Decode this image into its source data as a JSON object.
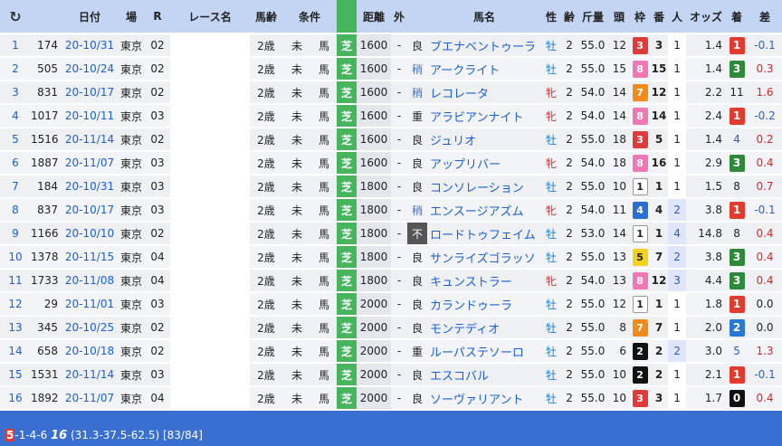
{
  "header": {
    "reload": "C",
    "cols": [
      "日付",
      "場",
      "R",
      "レース名",
      "馬齢",
      "条件",
      "",
      "距離",
      "外",
      "",
      "馬名",
      "性",
      "齢",
      "斤量",
      "頭",
      "枠",
      "番",
      "人",
      "オッズ",
      "着",
      "差"
    ]
  },
  "rows": [
    {
      "no": "1",
      "id": "174",
      "date": "20-10/31",
      "place": "東京",
      "r": "02",
      "race": "",
      "age": "2歳",
      "cond": "未",
      "horse_type": "馬",
      "track": "芝",
      "dist": "1600",
      "out": "-",
      "baba": "良",
      "name": "ブエナベントゥーラ",
      "sex": "牡",
      "sage": "2",
      "kin": "55.0",
      "tou": "12",
      "waku": "3",
      "ban": "3",
      "pop": "1",
      "odds": "1.4",
      "fin": "1",
      "diff": "-0.1"
    },
    {
      "no": "2",
      "id": "505",
      "date": "20-10/24",
      "place": "東京",
      "r": "02",
      "race": "",
      "age": "2歳",
      "cond": "未",
      "horse_type": "馬",
      "track": "芝",
      "dist": "1600",
      "out": "-",
      "baba": "稍",
      "name": "アークライト",
      "sex": "牡",
      "sage": "2",
      "kin": "55.0",
      "tou": "15",
      "waku": "8",
      "ban": "15",
      "pop": "1",
      "odds": "1.4",
      "fin": "3",
      "diff": "0.3"
    },
    {
      "no": "3",
      "id": "831",
      "date": "20-10/17",
      "place": "東京",
      "r": "02",
      "race": "",
      "age": "2歳",
      "cond": "未",
      "horse_type": "馬",
      "track": "芝",
      "dist": "1600",
      "out": "-",
      "baba": "稍",
      "name": "レコレータ",
      "sex": "牝",
      "sage": "2",
      "kin": "54.0",
      "tou": "14",
      "waku": "7",
      "ban": "12",
      "pop": "1",
      "odds": "2.2",
      "fin": "11",
      "diff": "1.6"
    },
    {
      "no": "4",
      "id": "1017",
      "date": "20-10/11",
      "place": "東京",
      "r": "03",
      "race": "",
      "age": "2歳",
      "cond": "未",
      "horse_type": "馬",
      "track": "芝",
      "dist": "1600",
      "out": "-",
      "baba": "重",
      "name": "アラビアンナイト",
      "sex": "牝",
      "sage": "2",
      "kin": "54.0",
      "tou": "14",
      "waku": "8",
      "ban": "14",
      "pop": "1",
      "odds": "2.4",
      "fin": "1",
      "diff": "-0.2"
    },
    {
      "no": "5",
      "id": "1516",
      "date": "20-11/14",
      "place": "東京",
      "r": "02",
      "race": "",
      "age": "2歳",
      "cond": "未",
      "horse_type": "馬",
      "track": "芝",
      "dist": "1600",
      "out": "-",
      "baba": "良",
      "name": "ジュリオ",
      "sex": "牡",
      "sage": "2",
      "kin": "55.0",
      "tou": "18",
      "waku": "3",
      "ban": "5",
      "pop": "1",
      "odds": "1.4",
      "fin": "4",
      "diff": "0.2"
    },
    {
      "no": "6",
      "id": "1887",
      "date": "20-11/07",
      "place": "東京",
      "r": "03",
      "race": "",
      "age": "2歳",
      "cond": "未",
      "horse_type": "馬",
      "track": "芝",
      "dist": "1600",
      "out": "-",
      "baba": "良",
      "name": "アップリバー",
      "sex": "牝",
      "sage": "2",
      "kin": "54.0",
      "tou": "18",
      "waku": "8",
      "ban": "16",
      "pop": "1",
      "odds": "2.9",
      "fin": "3",
      "diff": "0.4"
    },
    {
      "no": "7",
      "id": "184",
      "date": "20-10/31",
      "place": "東京",
      "r": "03",
      "race": "",
      "age": "2歳",
      "cond": "未",
      "horse_type": "馬",
      "track": "芝",
      "dist": "1800",
      "out": "-",
      "baba": "良",
      "name": "コンソレーション",
      "sex": "牡",
      "sage": "2",
      "kin": "55.0",
      "tou": "10",
      "waku": "1",
      "ban": "1",
      "pop": "1",
      "odds": "1.5",
      "fin": "8",
      "diff": "0.7"
    },
    {
      "no": "8",
      "id": "837",
      "date": "20-10/17",
      "place": "東京",
      "r": "03",
      "race": "",
      "age": "2歳",
      "cond": "未",
      "horse_type": "馬",
      "track": "芝",
      "dist": "1800",
      "out": "-",
      "baba": "稍",
      "name": "エンスージアズム",
      "sex": "牝",
      "sage": "2",
      "kin": "54.0",
      "tou": "11",
      "waku": "4",
      "ban": "4",
      "pop": "2",
      "odds": "3.8",
      "fin": "1",
      "diff": "-0.1"
    },
    {
      "no": "9",
      "id": "1166",
      "date": "20-10/10",
      "place": "東京",
      "r": "02",
      "race": "",
      "age": "2歳",
      "cond": "未",
      "horse_type": "馬",
      "track": "芝",
      "dist": "1800",
      "out": "-",
      "baba": "不",
      "name": "ロードトゥフェイム",
      "sex": "牡",
      "sage": "2",
      "kin": "53.0",
      "tou": "14",
      "waku": "1",
      "ban": "1",
      "pop": "4",
      "odds": "14.8",
      "fin": "8",
      "diff": "0.4"
    },
    {
      "no": "10",
      "id": "1378",
      "date": "20-11/15",
      "place": "東京",
      "r": "04",
      "race": "",
      "age": "2歳",
      "cond": "未",
      "horse_type": "馬",
      "track": "芝",
      "dist": "1800",
      "out": "-",
      "baba": "良",
      "name": "サンライズゴラッソ",
      "sex": "牡",
      "sage": "2",
      "kin": "55.0",
      "tou": "13",
      "waku": "5",
      "ban": "7",
      "pop": "2",
      "odds": "3.8",
      "fin": "3",
      "diff": "0.4"
    },
    {
      "no": "11",
      "id": "1733",
      "date": "20-11/08",
      "place": "東京",
      "r": "04",
      "race": "",
      "age": "2歳",
      "cond": "未",
      "horse_type": "馬",
      "track": "芝",
      "dist": "1800",
      "out": "-",
      "baba": "良",
      "name": "キュンストラー",
      "sex": "牝",
      "sage": "2",
      "kin": "54.0",
      "tou": "13",
      "waku": "8",
      "ban": "12",
      "pop": "3",
      "odds": "4.4",
      "fin": "3",
      "diff": "0.4"
    },
    {
      "no": "12",
      "id": "29",
      "date": "20-11/01",
      "place": "東京",
      "r": "03",
      "race": "",
      "age": "2歳",
      "cond": "未",
      "horse_type": "馬",
      "track": "芝",
      "dist": "2000",
      "out": "-",
      "baba": "良",
      "name": "カランドゥーラ",
      "sex": "牡",
      "sage": "2",
      "kin": "55.0",
      "tou": "12",
      "waku": "1",
      "ban": "1",
      "pop": "1",
      "odds": "1.8",
      "fin": "1",
      "diff": "0.0"
    },
    {
      "no": "13",
      "id": "345",
      "date": "20-10/25",
      "place": "東京",
      "r": "02",
      "race": "",
      "age": "2歳",
      "cond": "未",
      "horse_type": "馬",
      "track": "芝",
      "dist": "2000",
      "out": "-",
      "baba": "良",
      "name": "モンテディオ",
      "sex": "牡",
      "sage": "2",
      "kin": "55.0",
      "tou": "8",
      "waku": "7",
      "ban": "7",
      "pop": "1",
      "odds": "2.0",
      "fin": "2",
      "diff": "0.0"
    },
    {
      "no": "14",
      "id": "658",
      "date": "20-10/18",
      "place": "東京",
      "r": "02",
      "race": "",
      "age": "2歳",
      "cond": "未",
      "horse_type": "馬",
      "track": "芝",
      "dist": "2000",
      "out": "-",
      "baba": "重",
      "name": "ルーパステソーロ",
      "sex": "牡",
      "sage": "2",
      "kin": "55.0",
      "tou": "6",
      "waku": "2",
      "ban": "2",
      "pop": "2",
      "odds": "3.0",
      "fin": "5",
      "diff": "1.3"
    },
    {
      "no": "15",
      "id": "1531",
      "date": "20-11/14",
      "place": "東京",
      "r": "03",
      "race": "",
      "age": "2歳",
      "cond": "未",
      "horse_type": "馬",
      "track": "芝",
      "dist": "2000",
      "out": "-",
      "baba": "良",
      "name": "エスコバル",
      "sex": "牡",
      "sage": "2",
      "kin": "55.0",
      "tou": "10",
      "waku": "2",
      "ban": "2",
      "pop": "1",
      "odds": "2.1",
      "fin": "1",
      "diff": "-0.1"
    },
    {
      "no": "16",
      "id": "1892",
      "date": "20-11/07",
      "place": "東京",
      "r": "04",
      "race": "",
      "age": "2歳",
      "cond": "未",
      "horse_type": "馬",
      "track": "芝",
      "dist": "2000",
      "out": "-",
      "baba": "良",
      "name": "ソーヴァリアント",
      "sex": "牡",
      "sage": "2",
      "kin": "55.0",
      "tou": "10",
      "waku": "3",
      "ban": "3",
      "pop": "1",
      "odds": "1.7",
      "fin": "0",
      "diff": "0.4"
    }
  ],
  "footer": {
    "first": "5",
    "rest": "-1-4-6 ",
    "big": "16",
    "stats": " (31.3-37.5-62.5) [83/84]"
  }
}
